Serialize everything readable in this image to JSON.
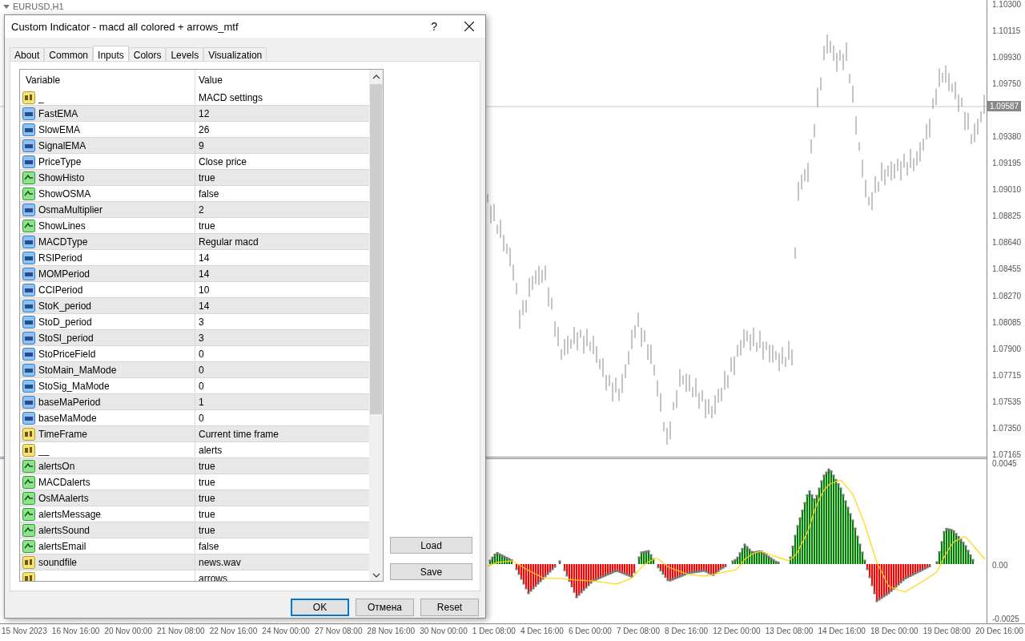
{
  "chart_window": {
    "title": "EURUSD,H1",
    "price_axis": [
      "1.10300",
      "1.10115",
      "1.09930",
      "1.09750",
      "1.09380",
      "1.09195",
      "1.09010",
      "1.08825",
      "1.08640",
      "1.08455",
      "1.08270",
      "1.08085",
      "1.07900",
      "1.07715",
      "1.07535",
      "1.07350",
      "1.07165"
    ],
    "current_price": "1.09587",
    "indicator_axis": [
      "0.0045",
      "0.00",
      "-0.0025"
    ],
    "time_axis": [
      "15 Nov 2023",
      "16 Nov 16:00",
      "20 Nov 00:00",
      "21 Nov 08:00",
      "22 Nov 16:00",
      "24 Nov 00:00",
      "27 Nov 08:00",
      "28 Nov 16:00",
      "30 Nov 00:00",
      "1 Dec 08:00",
      "4 Dec 16:00",
      "6 Dec 00:00",
      "7 Dec 08:00",
      "8 Dec 16:00",
      "12 Dec 00:00",
      "13 Dec 08:00",
      "14 Dec 16:00",
      "18 Dec 00:00",
      "19 Dec 08:00",
      "20 Dec 16:00"
    ]
  },
  "dialog": {
    "title": "Custom Indicator - macd all colored + arrows_mtf",
    "help": "?",
    "tabs": [
      {
        "label": "About",
        "selected": false
      },
      {
        "label": "Common",
        "selected": false
      },
      {
        "label": "Inputs",
        "selected": true
      },
      {
        "label": "Colors",
        "selected": false
      },
      {
        "label": "Levels",
        "selected": false
      },
      {
        "label": "Visualization",
        "selected": false
      }
    ],
    "table": {
      "columns": [
        "Variable",
        "Value"
      ],
      "rows": [
        {
          "kind": "text",
          "name": "_",
          "value": "MACD settings"
        },
        {
          "kind": "number",
          "name": "FastEMA",
          "value": "12"
        },
        {
          "kind": "number",
          "name": "SlowEMA",
          "value": "26"
        },
        {
          "kind": "number",
          "name": "SignalEMA",
          "value": "9"
        },
        {
          "kind": "number",
          "name": "PriceType",
          "value": "Close price"
        },
        {
          "kind": "bool",
          "name": "ShowHisto",
          "value": "true"
        },
        {
          "kind": "bool",
          "name": "ShowOSMA",
          "value": "false"
        },
        {
          "kind": "number",
          "name": "OsmaMultiplier",
          "value": "2"
        },
        {
          "kind": "bool",
          "name": "ShowLines",
          "value": "true"
        },
        {
          "kind": "number",
          "name": "MACDType",
          "value": "Regular macd"
        },
        {
          "kind": "number",
          "name": "RSIPeriod",
          "value": "14"
        },
        {
          "kind": "number",
          "name": "MOMPeriod",
          "value": "14"
        },
        {
          "kind": "number",
          "name": "CCIPeriod",
          "value": "10"
        },
        {
          "kind": "number",
          "name": "StoK_period",
          "value": "14"
        },
        {
          "kind": "number",
          "name": "StoD_period",
          "value": "3"
        },
        {
          "kind": "number",
          "name": "StoSl_period",
          "value": "3"
        },
        {
          "kind": "number",
          "name": "StoPriceField",
          "value": "0"
        },
        {
          "kind": "number",
          "name": "StoMain_MaMode",
          "value": "0"
        },
        {
          "kind": "number",
          "name": "StoSig_MaMode",
          "value": "0"
        },
        {
          "kind": "number",
          "name": "baseMaPeriod",
          "value": "1"
        },
        {
          "kind": "number",
          "name": "baseMaMode",
          "value": "0"
        },
        {
          "kind": "text",
          "name": "TimeFrame",
          "value": "Current time frame"
        },
        {
          "kind": "text",
          "name": "__",
          "value": "alerts"
        },
        {
          "kind": "bool",
          "name": "alertsOn",
          "value": "true"
        },
        {
          "kind": "bool",
          "name": "MACDalerts",
          "value": "true"
        },
        {
          "kind": "bool",
          "name": "OsMAalerts",
          "value": "true"
        },
        {
          "kind": "bool",
          "name": "alertsMessage",
          "value": "true"
        },
        {
          "kind": "bool",
          "name": "alertsSound",
          "value": "true"
        },
        {
          "kind": "bool",
          "name": "alertsEmail",
          "value": "false"
        },
        {
          "kind": "text",
          "name": "soundfile",
          "value": "news.wav"
        },
        {
          "kind": "text",
          "value": "arrows"
        }
      ]
    },
    "side_buttons": [
      "Load",
      "Save"
    ],
    "buttons": [
      {
        "label": "OK",
        "default": true
      },
      {
        "label": "Отмена",
        "default": false
      },
      {
        "label": "Reset",
        "default": false
      }
    ]
  }
}
